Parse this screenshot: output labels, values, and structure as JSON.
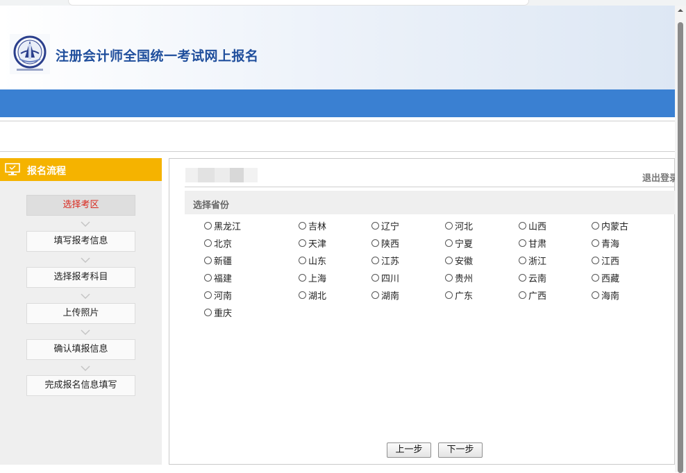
{
  "header": {
    "title": "注册会计师全国统一考试网上报名"
  },
  "sidebar": {
    "heading": "报名流程",
    "steps": [
      {
        "label": "选择考区",
        "active": true
      },
      {
        "label": "填写报考信息",
        "active": false
      },
      {
        "label": "选择报考科目",
        "active": false
      },
      {
        "label": "上传照片",
        "active": false
      },
      {
        "label": "确认填报信息",
        "active": false
      },
      {
        "label": "完成报名信息填写",
        "active": false
      }
    ]
  },
  "main": {
    "logout_label": "退出登录",
    "section_title": "选择省份",
    "provinces": [
      "黑龙江",
      "吉林",
      "辽宁",
      "河北",
      "山西",
      "内蒙古",
      "北京",
      "天津",
      "陕西",
      "宁夏",
      "甘肃",
      "青海",
      "新疆",
      "山东",
      "江苏",
      "安徽",
      "浙江",
      "江西",
      "福建",
      "上海",
      "四川",
      "贵州",
      "云南",
      "西藏",
      "河南",
      "湖北",
      "湖南",
      "广东",
      "广西",
      "海南",
      "重庆"
    ],
    "selected_province": null,
    "prev_label": "上一步",
    "next_label": "下一步"
  },
  "colors": {
    "brand_blue": "#3a80d2",
    "title_blue": "#1f4e9c",
    "sidebar_accent": "#f5b300",
    "active_step_text": "#d9261c"
  }
}
